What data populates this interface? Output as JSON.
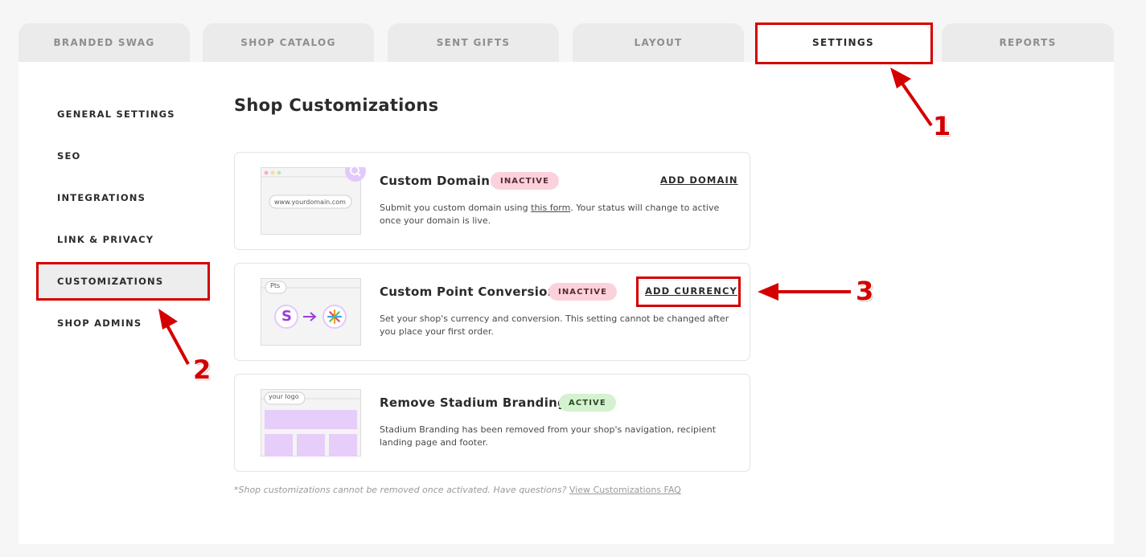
{
  "tabs": [
    {
      "label": "BRANDED SWAG"
    },
    {
      "label": "SHOP CATALOG"
    },
    {
      "label": "SENT GIFTS"
    },
    {
      "label": "LAYOUT"
    },
    {
      "label": "SETTINGS"
    },
    {
      "label": "REPORTS"
    }
  ],
  "sidebar": {
    "items": [
      {
        "label": "GENERAL SETTINGS"
      },
      {
        "label": "SEO"
      },
      {
        "label": "INTEGRATIONS"
      },
      {
        "label": "LINK & PRIVACY"
      },
      {
        "label": "CUSTOMIZATIONS"
      },
      {
        "label": "SHOP ADMINS"
      }
    ]
  },
  "main": {
    "title": "Shop Customizations",
    "cards": [
      {
        "title": "Custom Domain",
        "status": "INACTIVE",
        "action": "ADD DOMAIN",
        "desc_before": "Submit you custom domain using ",
        "desc_link": "this form",
        "desc_after": ". Your status will change to active once your domain is live.",
        "illus_text": "www.yourdomain.com"
      },
      {
        "title": "Custom Point Conversion",
        "status": "INACTIVE",
        "action": "ADD CURRENCY",
        "desc": "Set your shop's currency and conversion. This setting cannot be changed after you place your first order.",
        "illus_text": "Pts",
        "illus_letter": "S"
      },
      {
        "title": "Remove Stadium Branding",
        "status": "ACTIVE",
        "desc": "Stadium Branding has been removed from your shop's navigation, recipient landing page and footer.",
        "illus_text": "your logo"
      }
    ],
    "footnote": "*Shop customizations cannot be removed once activated. Have questions?",
    "footnote_link": "View Customizations FAQ"
  },
  "annotations": [
    "1",
    "2",
    "3"
  ],
  "colors": {
    "annotation_red": "#d40000",
    "inactive_badge": "#fbd2dc",
    "active_badge": "#d4f2cf",
    "accent_purple": "#9b3ddb"
  }
}
